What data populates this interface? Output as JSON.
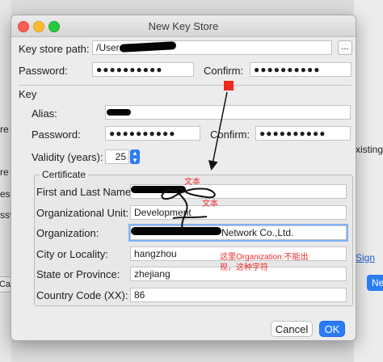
{
  "window": {
    "title": "New Key Store"
  },
  "keystore": {
    "path_label": "Key store path:",
    "path_value": "/Users/",
    "browse_label": "...",
    "password_label": "Password:",
    "password_value": "●●●●●●●●●●",
    "confirm_label": "Confirm:",
    "confirm_value": "●●●●●●●●●●"
  },
  "key": {
    "section_label": "Key",
    "alias_label": "Alias:",
    "alias_value": "",
    "password_label": "Password:",
    "password_value": "●●●●●●●●●●",
    "confirm_label": "Confirm:",
    "confirm_value": "●●●●●●●●●●",
    "validity_label": "Validity (years):",
    "validity_value": "25"
  },
  "certificate": {
    "title": "Certificate",
    "first_last_label": "First and Last Name:",
    "first_last_value": "",
    "org_unit_label": "Organizational Unit:",
    "org_unit_value": "Development",
    "org_label": "Organization:",
    "org_value": "Network Co.,Ltd.",
    "city_label": "City or Locality:",
    "city_value": "hangzhou",
    "state_label": "State or Province:",
    "state_value": "zhejiang",
    "country_label": "Country Code (XX):",
    "country_value": "86"
  },
  "buttons": {
    "cancel": "Cancel",
    "ok": "OK"
  },
  "annotations": {
    "text_label_1": "文本",
    "text_label_2": "文本",
    "organization_note_line1": "这里Organization:不能出",
    "organization_note_line2": "现，这种字符"
  },
  "background": {
    "frag_re1": "re",
    "frag_re2": "re",
    "frag_es": "es",
    "frag_ssw": "ssw",
    "frag_existing": "xisting",
    "frag_sign": "o Sign",
    "frag_ca": "Ca",
    "frag_ne": "Ne"
  },
  "colors": {
    "accent": "#2a7cf6",
    "annotation": "#ea2d2d"
  }
}
